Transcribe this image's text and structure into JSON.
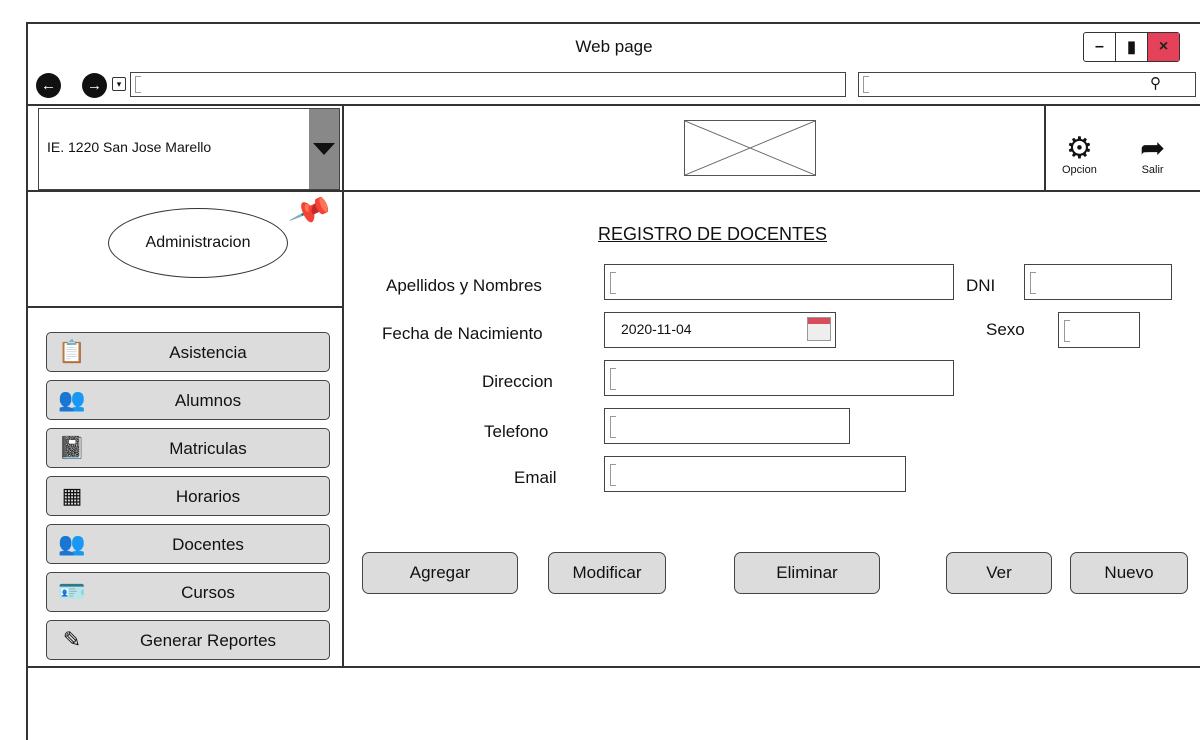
{
  "window": {
    "title": "Web page",
    "controls": [
      "–",
      "▮",
      "×"
    ]
  },
  "toolbar": {
    "url_value": "",
    "search_value": ""
  },
  "header": {
    "school": "IE. 1220 San Jose Marello",
    "opcion_label": "Opcion",
    "salir_label": "Salir"
  },
  "sidebar": {
    "section": "Administracion",
    "items": [
      {
        "label": "Asistencia",
        "icon": "clipboard-icon"
      },
      {
        "label": "Alumnos",
        "icon": "users-group-icon"
      },
      {
        "label": "Matriculas",
        "icon": "notebook-icon"
      },
      {
        "label": "Horarios",
        "icon": "table-icon"
      },
      {
        "label": "Docentes",
        "icon": "teachers-icon"
      },
      {
        "label": "Cursos",
        "icon": "id-card-icon"
      },
      {
        "label": "Generar Reportes",
        "icon": "edit-report-icon"
      }
    ]
  },
  "form": {
    "title": "REGISTRO DE DOCENTES",
    "labels": {
      "nombres": "Apellidos y Nombres",
      "dni": "DNI",
      "fecha": "Fecha de Nacimiento",
      "sexo": "Sexo",
      "direccion": "Direccion",
      "telefono": "Telefono",
      "email": "Email"
    },
    "values": {
      "fecha": "2020-11-04"
    }
  },
  "actions": {
    "agregar": "Agregar",
    "modificar": "Modificar",
    "eliminar": "Eliminar",
    "ver": "Ver",
    "nuevo": "Nuevo"
  }
}
